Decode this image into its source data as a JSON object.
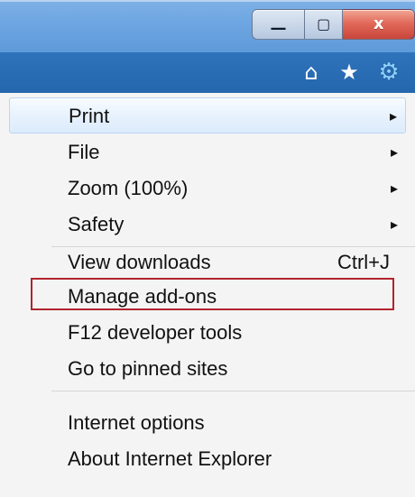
{
  "window": {
    "controls": {
      "minimize_glyph": "—",
      "maximize_glyph": "▢",
      "close_glyph": "x"
    }
  },
  "toolbar": {
    "icons": [
      "home-icon",
      "favorites-star-icon",
      "tools-gear-icon"
    ],
    "home_glyph": "⌂",
    "star_glyph": "★",
    "gear_glyph": "⚙"
  },
  "menu": {
    "items": [
      {
        "label": "Print",
        "has_submenu": true
      },
      {
        "label": "File",
        "has_submenu": true
      },
      {
        "label": "Zoom (100%)",
        "has_submenu": true
      },
      {
        "label": "Safety",
        "has_submenu": true
      },
      {
        "label": "View downloads",
        "shortcut": "Ctrl+J"
      },
      {
        "label": "Manage add-ons"
      },
      {
        "label": "F12 developer tools"
      },
      {
        "label": "Go to pinned sites"
      },
      {
        "label": "Internet options"
      },
      {
        "label": "About Internet Explorer"
      }
    ],
    "submenu_arrow": "▸",
    "highlighted_item": "Print",
    "outlined_item": "Manage add-ons"
  },
  "colors": {
    "outline_red": "#b0242d",
    "hover_blue": "#dcebfb"
  }
}
